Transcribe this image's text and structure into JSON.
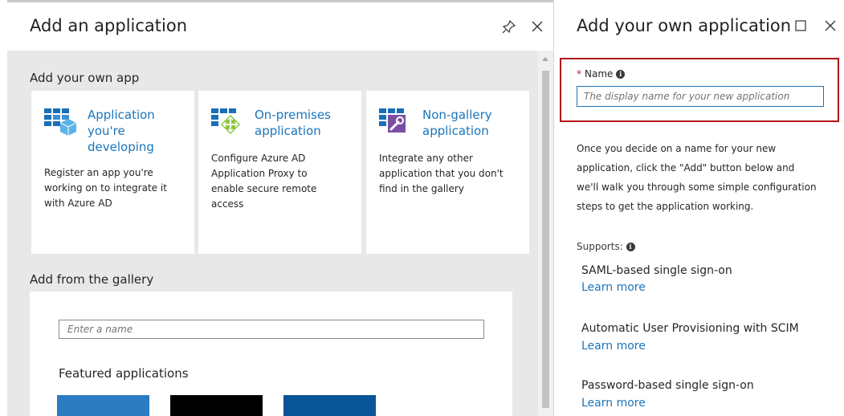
{
  "left_blade": {
    "title": "Add an application",
    "pin_icon": "pin-icon",
    "close_icon": "close-icon",
    "own_app_section": "Add your own app",
    "tiles": [
      {
        "title_lines": [
          "Application",
          "you're",
          "developing"
        ],
        "description_lines": [
          "Register an app you're",
          "working on to integrate it",
          "with Azure AD"
        ],
        "icon": "app-developing-icon"
      },
      {
        "title_lines": [
          "On-premises",
          "application"
        ],
        "description_lines": [
          "Configure Azure AD",
          "Application Proxy to",
          "enable secure remote",
          "access"
        ],
        "icon": "on-premises-app-icon"
      },
      {
        "title_lines": [
          "Non-gallery",
          "application"
        ],
        "description_lines": [
          "Integrate any other",
          "application that you don't",
          "find in the gallery"
        ],
        "icon": "non-gallery-app-icon"
      }
    ],
    "gallery_section": "Add from the gallery",
    "gallery_search_placeholder": "Enter a name",
    "featured_title": "Featured applications",
    "featured_apps": [
      {
        "color": "#2b7cc0"
      },
      {
        "color": "#000000"
      },
      {
        "color": "#0a5598"
      }
    ]
  },
  "right_blade": {
    "title": "Add your own application",
    "maximize_icon": "maximize-icon",
    "close_icon": "close-icon",
    "name_label": "Name",
    "name_required_marker": "*",
    "name_placeholder": "The display name for your new application",
    "description_lines": [
      "Once you decide on a name for your new",
      "application, click the \"Add\" button below and",
      "we'll walk you through some simple configuration",
      "steps to get the application working."
    ],
    "supports_label": "Supports:",
    "supports": [
      {
        "name": "SAML-based single sign-on",
        "link": "Learn more"
      },
      {
        "name": "Automatic User Provisioning with SCIM",
        "link": "Learn more"
      },
      {
        "name": "Password-based single sign-on",
        "link": "Learn more"
      }
    ]
  },
  "colors": {
    "accent": "#1b75bb",
    "highlight_border": "#b3121b",
    "required": "#c11b1b",
    "blade_background": "#e8e8e8"
  }
}
